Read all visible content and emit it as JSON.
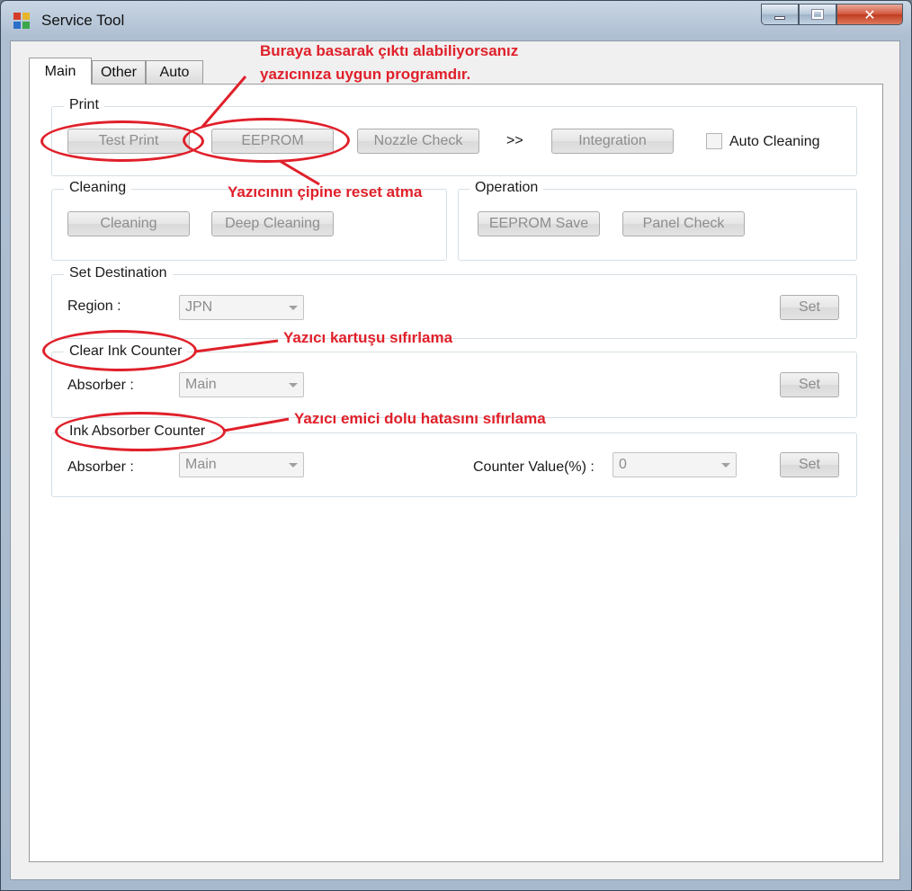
{
  "window": {
    "title": "Service Tool",
    "close_glyph": "✕"
  },
  "tabs": [
    {
      "label": "Main"
    },
    {
      "label": "Other"
    },
    {
      "label": "Auto"
    }
  ],
  "print_group": {
    "label": "Print",
    "test_print": "Test Print",
    "eeprom": "EEPROM",
    "nozzle_check": "Nozzle Check",
    "arrow": ">>",
    "integration": "Integration",
    "auto_cleaning": "Auto Cleaning"
  },
  "cleaning_group": {
    "label": "Cleaning",
    "cleaning": "Cleaning",
    "deep_cleaning": "Deep Cleaning"
  },
  "operation_group": {
    "label": "Operation",
    "eeprom_save": "EEPROM Save",
    "panel_check": "Panel Check"
  },
  "destination_group": {
    "label": "Set Destination",
    "region_label": "Region :",
    "region_value": "JPN",
    "set": "Set"
  },
  "clear_ink_group": {
    "label": "Clear Ink Counter",
    "absorber_label": "Absorber :",
    "absorber_value": "Main",
    "set": "Set"
  },
  "ink_absorber_group": {
    "label": "Ink Absorber Counter",
    "absorber_label": "Absorber :",
    "absorber_value": "Main",
    "counter_label": "Counter Value(%) :",
    "counter_value": "0",
    "set": "Set"
  },
  "annotations": {
    "print_note_line1": "Buraya basarak çıktı alabiliyorsanız",
    "print_note_line2": "yazıcınıza uygun programdır.",
    "eeprom_note": "Yazıcının çipine reset atma",
    "clear_ink_note": "Yazıcı kartuşu sıfırlama",
    "absorber_note": "Yazıcı emici dolu hatasını sıfırlama"
  },
  "colors": {
    "annotation_red": "#e0202a",
    "disabled_text": "#8d8d8d"
  }
}
